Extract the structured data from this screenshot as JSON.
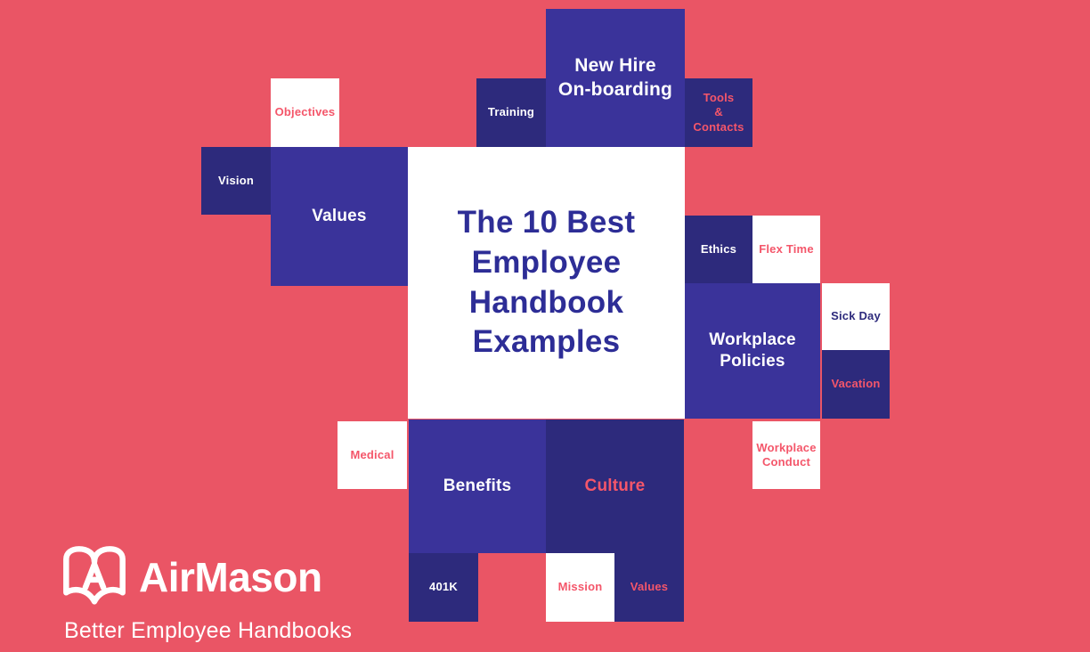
{
  "colors": {
    "background_coral": "#ea5565",
    "navy": "#2d2a7c",
    "indigo": "#3a339a",
    "white": "#ffffff",
    "title_text": "#2d2d96",
    "coral_text": "#f4566a"
  },
  "title_card": {
    "heading": "The 10 Best\nEmployee\nHandbook\nExamples"
  },
  "tiles": [
    {
      "label": "Objectives"
    },
    {
      "label": "Training"
    },
    {
      "label": "New Hire\nOn-boarding"
    },
    {
      "label": "Tools\n&\nContacts"
    },
    {
      "label": "Vision"
    },
    {
      "label": "Values"
    },
    {
      "label": "Ethics"
    },
    {
      "label": "Flex Time"
    },
    {
      "label": "Workplace\nPolicies"
    },
    {
      "label": "Sick Day"
    },
    {
      "label": "Vacation"
    },
    {
      "label": "Medical"
    },
    {
      "label": "Benefits"
    },
    {
      "label": "Culture"
    },
    {
      "label": "Workplace\nConduct"
    },
    {
      "label": "401K"
    },
    {
      "label": "Mission"
    },
    {
      "label": "Values"
    }
  ],
  "logo": {
    "wordmark": "AirMason",
    "tagline": "Better Employee Handbooks",
    "mark": "open-book-with-a-icon"
  }
}
